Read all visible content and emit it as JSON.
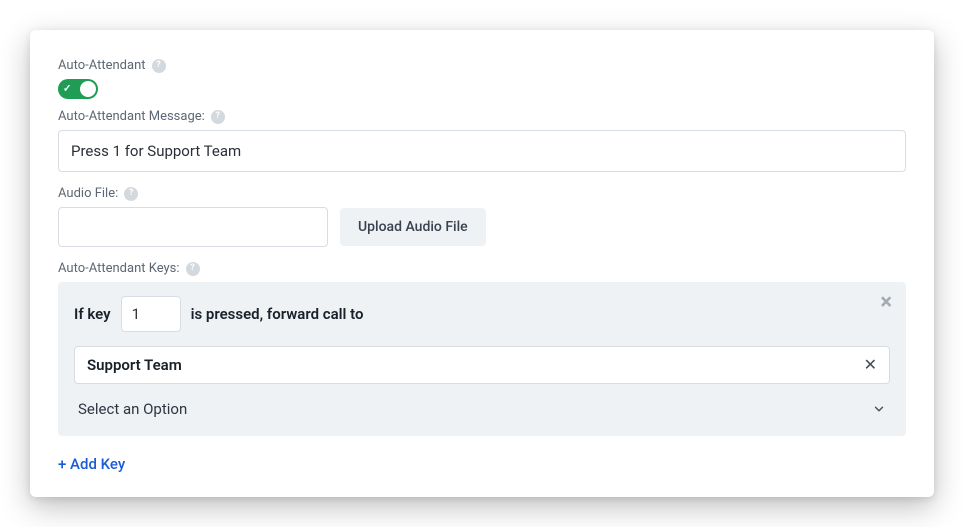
{
  "labels": {
    "auto_attendant": "Auto-Attendant",
    "message": "Auto-Attendant Message:",
    "audio_file": "Audio File:",
    "keys": "Auto-Attendant Keys:"
  },
  "toggle": {
    "on": true
  },
  "message_input": {
    "value": "Press 1 for Support Team"
  },
  "upload_button": "Upload Audio File",
  "key_row": {
    "prefix": "If key",
    "value": "1",
    "suffix": "is pressed, forward call to"
  },
  "selected_team": "Support Team",
  "select_placeholder": "Select an Option",
  "add_key": "+ Add Key"
}
